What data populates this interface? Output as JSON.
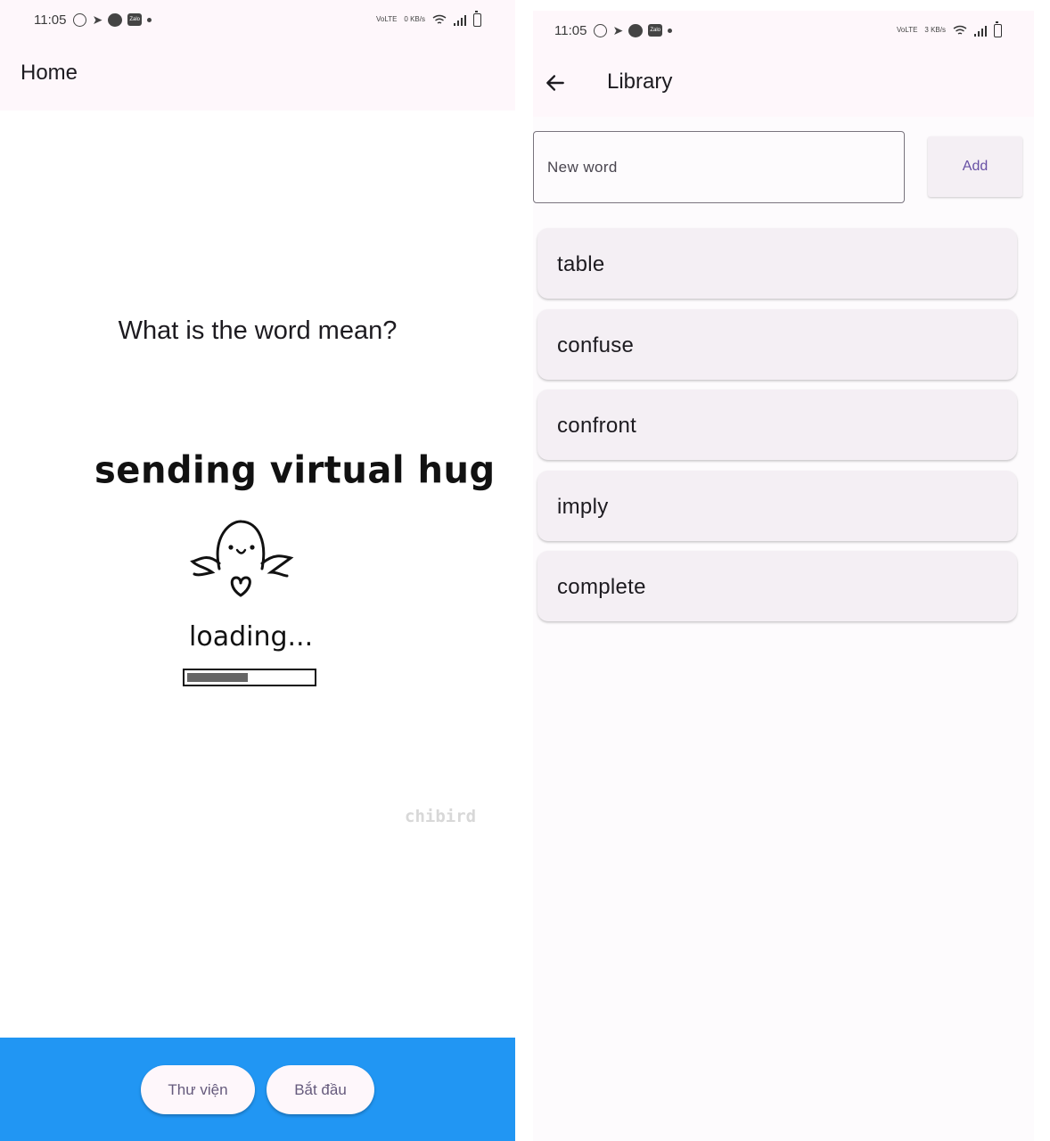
{
  "status_bar": {
    "time": "11:05",
    "volte": "VoLTE",
    "net_speed_left": "0 KB/s",
    "net_speed_right": "3 KB/s"
  },
  "home": {
    "title": "Home",
    "question": "What is the word mean?",
    "image": {
      "caption": "sending virtual hug",
      "loading_text": "loading...",
      "signature": "chibird",
      "progress": 0.5
    },
    "buttons": {
      "library": "Thư viện",
      "start": "Bắt đầu"
    },
    "colors": {
      "bottom_bar": "#2196f3",
      "app_bar": "#fef7fb"
    }
  },
  "library": {
    "title": "Library",
    "input": {
      "placeholder": "New word",
      "value": ""
    },
    "add_label": "Add",
    "words": [
      "table",
      "confuse",
      "confront",
      "imply",
      "complete"
    ]
  }
}
